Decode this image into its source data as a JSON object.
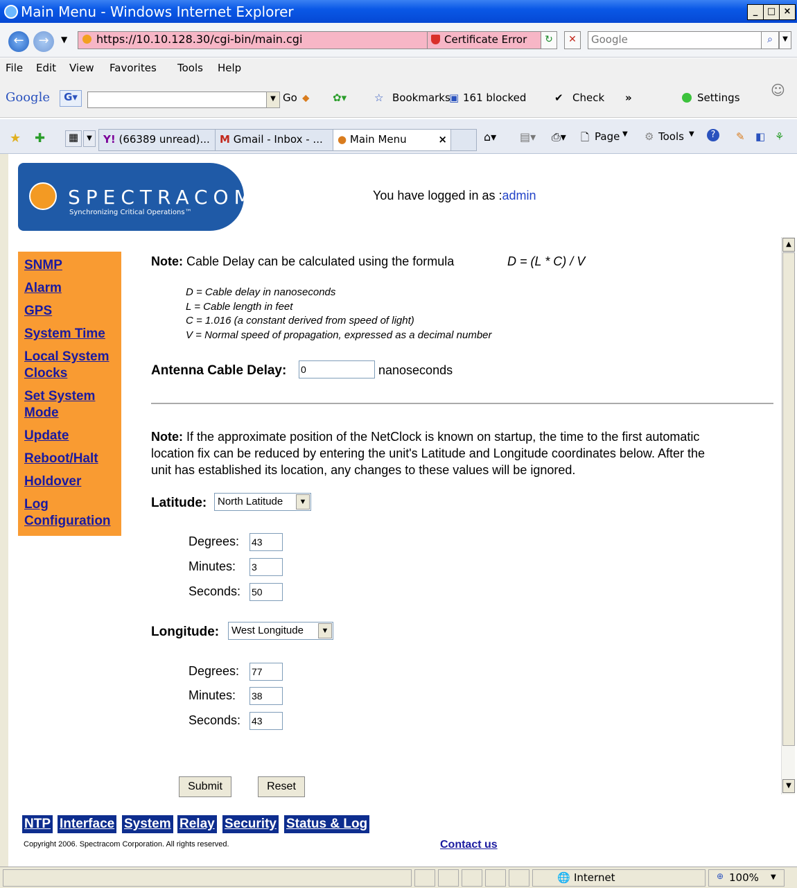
{
  "window": {
    "title": "Main Menu - Windows Internet Explorer"
  },
  "address_bar": {
    "url": "https://10.10.128.30/cgi-bin/main.cgi",
    "cert_error": "Certificate Error",
    "search_placeholder": "Google"
  },
  "menu": [
    "File",
    "Edit",
    "View",
    "Favorites",
    "Tools",
    "Help"
  ],
  "google_toolbar": {
    "logo": "Google",
    "go": "Go",
    "bookmarks": "Bookmarks",
    "blocked": "161 blocked",
    "check": "Check",
    "settings": "Settings"
  },
  "tabs": [
    {
      "label": "(66389 unread)..."
    },
    {
      "label": "Gmail - Inbox - ..."
    },
    {
      "label": "Main Menu"
    }
  ],
  "command_bar": {
    "page": "Page",
    "tools": "Tools"
  },
  "page": {
    "brand": "SPECTRACOM",
    "tagline": "Synchronizing Critical Operations™",
    "logged_in_prefix": "You have logged in as :",
    "user": "admin",
    "sidebar": [
      "SNMP",
      "Alarm",
      "GPS",
      "System Time",
      "Local System",
      "Clocks",
      "Set System",
      "Mode",
      "Update",
      "Reboot/Halt",
      "Holdover",
      "Log",
      "Configuration"
    ],
    "note1": {
      "label": "Note:",
      "text": "Cable Delay can be calculated using the formula",
      "formula": "D = (L * C) / V"
    },
    "definitions": [
      "D = Cable delay in nanoseconds",
      "L = Cable length in feet",
      "C = 1.016 (a constant derived from speed of light)",
      "V = Normal speed of propagation, expressed as a decimal number"
    ],
    "cable_delay": {
      "label": "Antenna Cable Delay:",
      "value": "0",
      "unit": "nanoseconds"
    },
    "note2": {
      "label": "Note:",
      "line1": "If the approximate position of the NetClock is known on startup, the time to the first automatic",
      "line2": "location fix can be reduced by entering the unit's Latitude and Longitude coordinates below. After the",
      "line3": "unit has established its location, any changes to these values will be ignored."
    },
    "latitude": {
      "label": "Latitude:",
      "selected": "North Latitude",
      "degrees_label": "Degrees:",
      "degrees": "43",
      "minutes_label": "Minutes:",
      "minutes": "3",
      "seconds_label": "Seconds:",
      "seconds": "50"
    },
    "longitude": {
      "label": "Longitude:",
      "selected": "West Longitude",
      "degrees_label": "Degrees:",
      "degrees": "77",
      "minutes_label": "Minutes:",
      "minutes": "38",
      "seconds_label": "Seconds:",
      "seconds": "43"
    },
    "submit": "Submit",
    "reset": "Reset",
    "bottom_nav": [
      "NTP",
      "Interface",
      "System",
      "Relay",
      "Security",
      "Status & Log"
    ],
    "copyright": "Copyright 2006. Spectracom Corporation. All rights reserved.",
    "contact": "Contact us"
  },
  "status_bar": {
    "zone": "Internet",
    "zoom": "100%"
  }
}
